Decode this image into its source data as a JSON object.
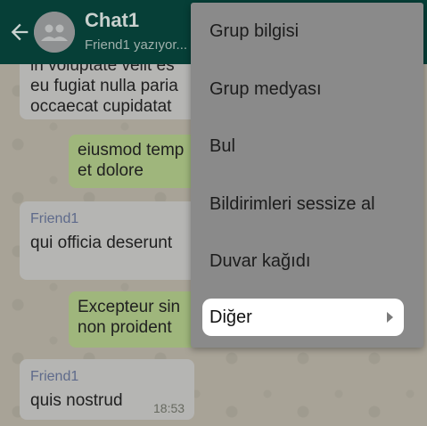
{
  "header": {
    "title": "Chat1",
    "status": "Friend1 yazıyor..."
  },
  "messages": [
    {
      "direction": "in",
      "lines": [
        "in voluptate velit es",
        "eu fugiat nulla paria",
        "occaecat cupidatat"
      ]
    },
    {
      "direction": "out",
      "lines": [
        "eiusmod temp",
        "et dolore"
      ]
    },
    {
      "direction": "in",
      "sender": "Friend1",
      "lines": [
        "qui officia deserunt"
      ]
    },
    {
      "direction": "out",
      "lines": [
        "Excepteur sin",
        "non proident"
      ]
    },
    {
      "direction": "in",
      "sender": "Friend1",
      "lines": [
        "quis nostrud"
      ],
      "time": "18:53"
    }
  ],
  "menu": {
    "items": [
      {
        "label": "Grup bilgisi"
      },
      {
        "label": "Grup medyası"
      },
      {
        "label": "Bul"
      },
      {
        "label": "Bildirimleri sessize al"
      },
      {
        "label": "Duvar kağıdı"
      },
      {
        "label": "Diğer",
        "has_submenu": true,
        "highlighted": true
      }
    ]
  },
  "icons": {
    "back": "arrow-left-icon",
    "avatar": "group-avatar-icon",
    "submenu": "chevron-right-icon"
  },
  "colors": {
    "app_bar": "#063f37",
    "outgoing_bubble": "#9fb67c",
    "incoming_bubble": "#b5b5b3",
    "menu_background": "#8a8a8a",
    "highlight": "#ffffff"
  }
}
